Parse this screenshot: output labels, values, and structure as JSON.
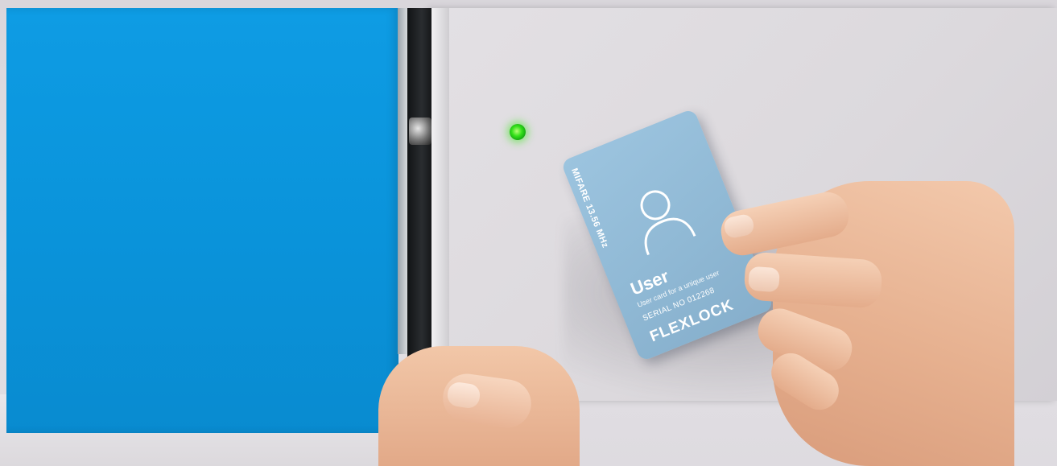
{
  "scene": {
    "description_colors": {
      "blue_door": "#0a93da",
      "white_door": "#dcd9dd",
      "led": "#34e01a",
      "card": "#8fb8d4"
    }
  },
  "card": {
    "frequency": "MIFARE 13.56 MHz",
    "title": "User",
    "description": "User card for a unique user",
    "serial": "SERIAL NO 012268",
    "brand": "FLEXLOCK"
  }
}
